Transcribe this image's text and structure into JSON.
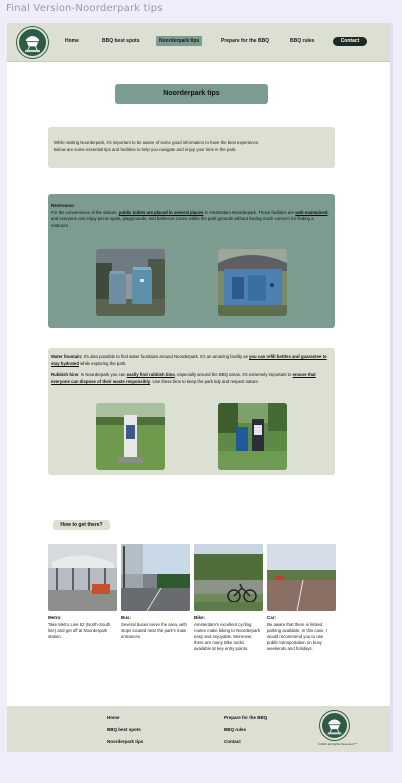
{
  "frame_title": "Final Version-Noorderpark tips",
  "header": {
    "nav": [
      {
        "label": "Home",
        "active": false
      },
      {
        "label": "BBQ best spots",
        "active": false
      },
      {
        "label": "Noorderpark tips",
        "active": true
      },
      {
        "label": "Prepare for the BBQ",
        "active": false
      },
      {
        "label": "BBQ rules",
        "active": false
      }
    ],
    "contact_label": "Contact",
    "logo_text": "GRILL & CHILL"
  },
  "title": "Noorderpark tips",
  "intro": {
    "line1": "While visiting Noorderpark, it's important to be aware of some good information to have the best experience.",
    "line2": "Below are some essential tips and facilities to help you navigate and enjoy your time in the park."
  },
  "restrooms": {
    "heading": "Restrooms:",
    "t1": "For the convenience of the visitors, ",
    "t2": "public toilets are placed in several places",
    "t3": " in Amsterdam Noorderpark. Those facilities are ",
    "t4": "well-maintained",
    "t5": ", and everyone can enjoy picnic spots, playgrounds, and barbecue zones within the park grounds without having much concern for finding a restroom."
  },
  "water": {
    "heading": "Water fountain:",
    "t1": " It's also possible to find water fountains around Noorderpark. It's an amazing facility as ",
    "t2": "you can refill bottles and guarantee to stay hydrated",
    "t3": " while exploring the park."
  },
  "bins": {
    "heading": "Rubbish bins",
    "t1": ": In Noorderpark you can ",
    "t2": "easily find rubbish bins",
    "t3": ", especially around the BBQ areas. It's extremely important to ",
    "t4": "ensure that everyone can dispose of their waste responsibly",
    "t5": ". Use these bins to keep the park tidy and respect nature."
  },
  "howto": {
    "title": "How to get there?",
    "items": [
      {
        "title": "Metro:",
        "desc": "Take Metro Line 52 (North-South line) and get off at Noorderpark station."
      },
      {
        "title": "Bus:",
        "desc": "Several buses serve the area, with stops located near the park's main entrances."
      },
      {
        "title": "Bike:",
        "desc": "Amsterdam's excellent cycling routes make biking to Noorderpark easy and enjoyable. Moreover, there are many Bike racks available at key entry points."
      },
      {
        "title": "Car:",
        "desc": "Be aware that there is limited parking available. In this case, I would recommend you to use public transportation on busy weekends and holidays."
      }
    ]
  },
  "footer": {
    "col1": [
      "Home",
      "BBQ best spots",
      "Noorderpark tips"
    ],
    "col2": [
      "Prepare for the BBQ",
      "BBQ rules",
      "Contact"
    ],
    "copyright": "©2024 all Rights Reserved™"
  }
}
